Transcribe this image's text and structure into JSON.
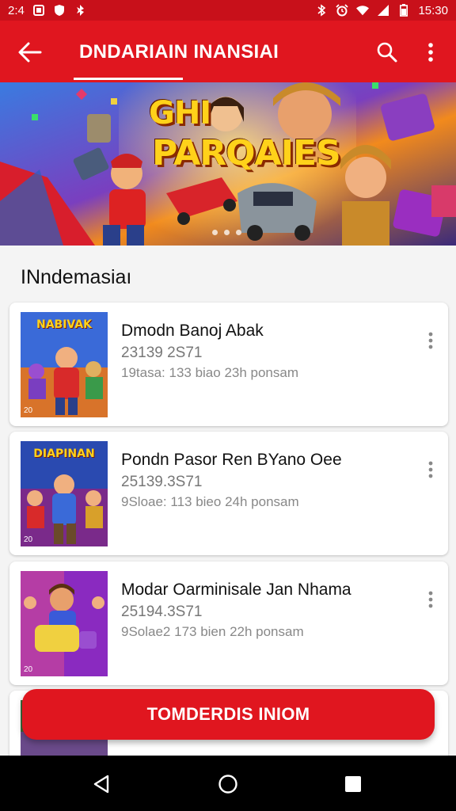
{
  "status_bar": {
    "time_left": "2:4",
    "time_right": "15:30",
    "icons_left": [
      "square-icon",
      "shield-icon",
      "gear-icon"
    ],
    "icons_right": [
      "bluetooth-icon",
      "alarm-icon",
      "wifi-icon",
      "signal-icon",
      "battery-icon"
    ]
  },
  "app_bar": {
    "title": "DNDARIAIN INANSIAI",
    "back_icon": "arrow-left-icon",
    "search_icon": "search-icon",
    "more_icon": "more-vert-icon"
  },
  "banner": {
    "title_line1": "GHI",
    "title_line2": "PARQAIES",
    "page_count": 3
  },
  "section": {
    "title": "INndemasiaı"
  },
  "items": [
    {
      "title": "Dmodn Banoj Abak",
      "subtitle": "23139 2S71",
      "meta": "19tasa: 133 biao 23h ponsam",
      "thumb_label": "NABIVAK",
      "thumb_corner": "20"
    },
    {
      "title": "Pondn Pasor Ren BYano Oee",
      "subtitle": "25139.3S71",
      "meta": "9Sloae: 113 bieo 24h ponsam",
      "thumb_label": "DIAPINAN",
      "thumb_corner": "20"
    },
    {
      "title": "Modar Oarminisale Jan Nhama",
      "subtitle": "25194.3S71",
      "meta": "9Solae2 173 bien 22h ponsam",
      "thumb_label": "",
      "thumb_corner": "20"
    }
  ],
  "cta": {
    "label": "TOMDERDIS INIOM"
  },
  "nav": {
    "back_icon": "nav-back-icon",
    "home_icon": "nav-home-icon",
    "recents_icon": "nav-recents-icon"
  },
  "colors": {
    "primary": "#e0161f",
    "status": "#c8101a",
    "background": "#f4f4f4"
  }
}
